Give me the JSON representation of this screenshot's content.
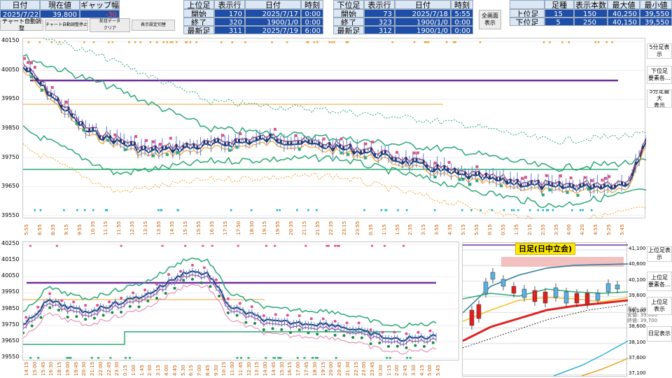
{
  "header_left": {
    "date_label": "日付",
    "price_label": "現在値",
    "gap_label": "ギャップ幅",
    "date": "2025/7/22",
    "price": "39,800",
    "gap": "-30"
  },
  "buttons": {
    "auto_adjust": "チャート自動調整",
    "auto_adjust_stop": "チャート自動調整停止",
    "clear_prev": "前日データ\nクリア",
    "unknown": "表示設定切替"
  },
  "upper_block": {
    "title": "上位足",
    "display_row": "表示行",
    "date_col": "日付",
    "time_col": "時刻",
    "start_label": "開始",
    "end_label": "終了",
    "latest_label": "最新足",
    "start_row": "170",
    "end_row": "320",
    "latest_row": "311",
    "start_date": "2025/7/17",
    "end_date": "1900/1/0",
    "latest_date": "2025/7/19",
    "start_time": "0:00",
    "end_time": "0:00",
    "latest_time": "6:00"
  },
  "lower_block": {
    "title": "下位足",
    "display_row": "表示行",
    "date_col": "日付",
    "time_col": "時刻",
    "start_label": "開始",
    "end_label": "終了",
    "latest_label": "最新足",
    "start_row": "73",
    "end_row": "323",
    "latest_row": "312",
    "start_date": "2025/7/18",
    "end_date": "1900/1/0",
    "latest_date": "1900/1/0",
    "start_time": "5:55",
    "end_time": "0:00",
    "latest_time": "0:00"
  },
  "fullscreen_button": "全画面\n表示",
  "right_table": {
    "col_foot": "足種",
    "col_count": "表示本数",
    "col_max": "最大値",
    "col_min": "最小値",
    "rows": [
      {
        "label": "上位足",
        "foot": "15",
        "count": "150",
        "max": "40,250",
        "min": "39,550"
      },
      {
        "label": "下位足",
        "foot": "5",
        "count": "250",
        "max": "40,150",
        "min": "39,550"
      }
    ]
  },
  "side_buttons": {
    "b1": "5分足表示",
    "b2": "下位足\n要素各…",
    "b3": "5分足最大\n表示",
    "b4": "上位足表示",
    "b5": "上位足\n要素各…",
    "b6": "上位足\n表示",
    "b7": "日足表示"
  },
  "top_chart": {
    "y_ticks": [
      "40150",
      "40050",
      "39950",
      "39850",
      "39750",
      "39650",
      "39550"
    ],
    "x_ticks": [
      "5:55",
      "6:55",
      "8:35",
      "9:15",
      "9:55",
      "10:35",
      "11:15",
      "11:55",
      "12:35",
      "13:15",
      "13:55",
      "14:35",
      "15:15",
      "15:55",
      "16:35",
      "17:15",
      "17:50",
      "18:30",
      "19:15",
      "19:55",
      "20:35",
      "21:15",
      "21:55",
      "22:35",
      "23:15",
      "23:55",
      "0:35",
      "1:15",
      "1:55",
      "2:35",
      "3:15",
      "3:55",
      "4:35",
      "5:15",
      "5:55",
      "0:15",
      "0:55",
      "1:35",
      "2:15",
      "2:55",
      "3:35",
      "4:00",
      "4:20",
      "4:55",
      "5:25",
      "5:45"
    ]
  },
  "bottom_chart": {
    "y_ticks": [
      "40250",
      "40150",
      "40050",
      "39950",
      "39850",
      "39750",
      "39650",
      "39550"
    ],
    "x_ticks": [
      "14:15",
      "15:00",
      "15:45",
      "16:30",
      "18:15",
      "19:00",
      "19:45",
      "20:30",
      "21:15",
      "22:00",
      "22:45",
      "23:30",
      "0:15",
      "1:00",
      "1:45",
      "2:30",
      "3:15",
      "4:00",
      "4:45",
      "5:30",
      "6:15",
      "7:00",
      "8:45",
      "9:30",
      "10:15",
      "11:00",
      "11:45",
      "12:30",
      "13:15",
      "14:00",
      "14:45",
      "15:30",
      "16:15",
      "17:00",
      "17:45",
      "18:30",
      "19:15",
      "20:00",
      "20:45",
      "21:30",
      "22:15",
      "23:00",
      "23:45",
      "0:30",
      "1:15",
      "2:00",
      "2:45",
      "3:30",
      "4:15",
      "5:00",
      "5:45"
    ]
  },
  "daily_chart": {
    "title": "日足(日中立会)",
    "legend": "高値: 39,800\n安値: 39,600\n終値: 39,700",
    "y_ticks": [
      "41,100",
      "40,600",
      "40,100",
      "39,600",
      "39,100",
      "38,600",
      "38,100",
      "37,600",
      "37,100"
    ]
  },
  "colors": {
    "accent_blue": "#1f4ea8",
    "header_bg": "#dbe7f5",
    "purple_line": "#7030a0",
    "green_line": "#2aa876",
    "navy_line": "#1f3a6e",
    "orange_line": "#f0a030",
    "candle_blue": "#5a7fd8",
    "pink_marker": "#e0508a",
    "cyan_marker": "#00b8c8"
  }
}
